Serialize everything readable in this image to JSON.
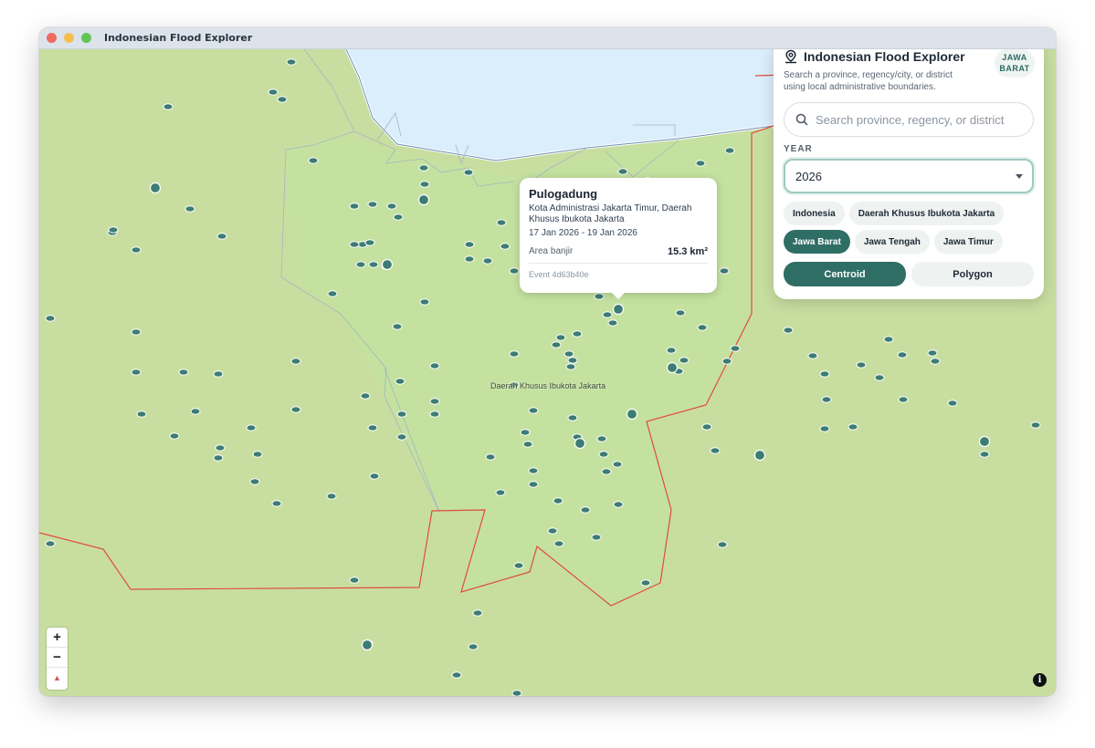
{
  "window": {
    "title": "Indonesian Flood Explorer"
  },
  "map": {
    "region_label": "Daerah Khusus Ibukota Jakarta",
    "colors": {
      "land": "#c8dea0",
      "land_highlight": "#c4e1a0",
      "water": "#dbeefb",
      "boundary": "#e04c3c",
      "marker": "#3d7c73"
    }
  },
  "popup": {
    "title": "Pulogadung",
    "subtitle": "Kota Administrasi Jakarta Timur, Daerah Khusus Ibukota Jakarta",
    "date_range": "17 Jan 2026 - 19 Jan 2026",
    "area_label": "Area banjir",
    "area_value": "15.3 km²",
    "event": "Event 4d63b40e"
  },
  "panel": {
    "title": "Indonesian Flood Explorer",
    "badge": "JAWA BARAT",
    "description": "Search a province, regency/city, or district using local administrative boundaries.",
    "search_placeholder": "Search province, regency, or district",
    "year_label": "YEAR",
    "year_value": "2026",
    "regions": [
      {
        "label": "Indonesia",
        "active": false
      },
      {
        "label": "Daerah Khusus Ibukota Jakarta",
        "active": false
      },
      {
        "label": "Jawa Barat",
        "active": true
      },
      {
        "label": "Jawa Tengah",
        "active": false
      },
      {
        "label": "Jawa Timur",
        "active": false
      }
    ],
    "modes": [
      {
        "label": "Centroid",
        "active": true
      },
      {
        "label": "Polygon",
        "active": false
      }
    ]
  },
  "controls": {
    "zoom_in": "+",
    "zoom_out": "−",
    "compass": "▲",
    "info": "i"
  },
  "icons": [
    "search-icon",
    "map-pin-icon",
    "info-icon",
    "compass-icon"
  ]
}
